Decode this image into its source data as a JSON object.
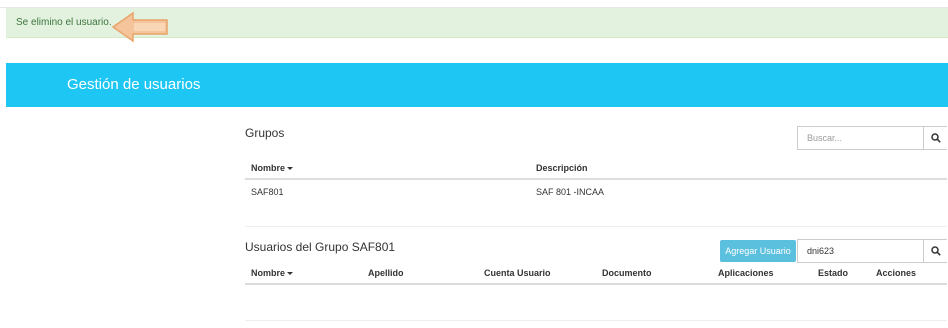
{
  "alert": {
    "message": "Se elimino el usuario."
  },
  "banner": {
    "title": "Gestión de usuarios"
  },
  "groups": {
    "title": "Grupos",
    "search_placeholder": "Buscar...",
    "columns": [
      "Nombre",
      "Descripción"
    ],
    "rows": [
      {
        "nombre": "SAF801",
        "descripcion": "SAF 801 -INCAA"
      }
    ]
  },
  "users": {
    "title": "Usuarios del Grupo SAF801",
    "add_button": "Agregar Usuario",
    "search_value": "dni623",
    "columns": [
      "Nombre",
      "Apellido",
      "Cuenta Usuario",
      "Documento",
      "Aplicaciones",
      "Estado",
      "Acciones"
    ]
  },
  "colors": {
    "banner": "#1ec6f4",
    "alert_bg": "#e3f1df",
    "add_button": "#5bc0de"
  },
  "icons": {
    "alert_arrow": "left-arrow-icon",
    "search": "search-icon",
    "sort": "caret-down-icon"
  }
}
